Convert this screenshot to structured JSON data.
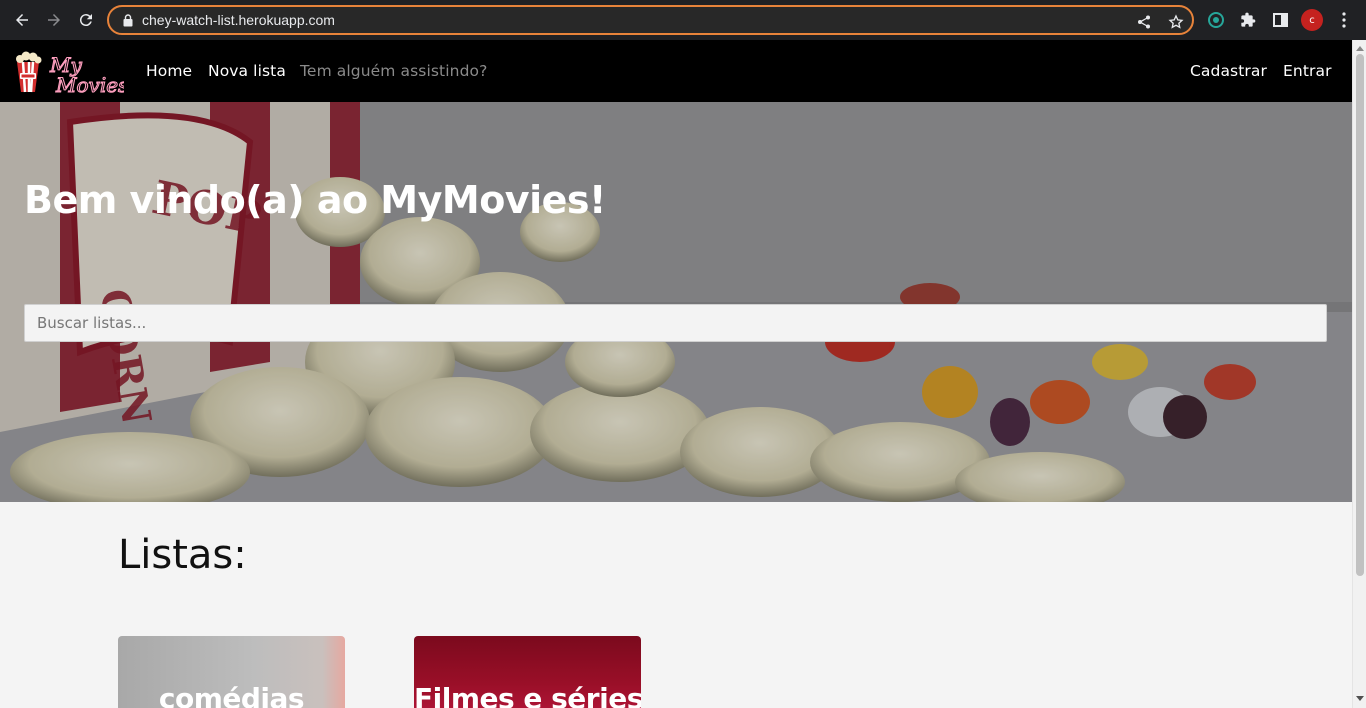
{
  "browser": {
    "url": "chey-watch-list.herokuapp.com",
    "profile_initial": "c",
    "icons": [
      "back-icon",
      "forward-icon",
      "reload-icon",
      "lock-icon",
      "share-icon",
      "star-icon",
      "extension-icon",
      "puzzle-icon",
      "sidepanel-icon",
      "menu-icon"
    ]
  },
  "site": {
    "logo_text": [
      "My",
      "Movies"
    ],
    "nav": {
      "home": "Home",
      "new_list": "Nova lista",
      "watching": "Tem alguém assistindo?",
      "register": "Cadastrar",
      "login": "Entrar"
    },
    "hero": {
      "title": "Bem vindo(a) ao MyMovies!",
      "search_placeholder": "Buscar listas..."
    },
    "lists_section": {
      "title": "Listas:",
      "cards": [
        {
          "title": "comédias"
        },
        {
          "title": "Filmes e séries"
        }
      ]
    }
  },
  "colors": {
    "omnibox_focus": "#e8833a",
    "navbar_bg": "#000000",
    "page_bg": "#f4f4f4",
    "card2_bg": "#9a0f28",
    "avatar_bg": "#c5221f"
  }
}
